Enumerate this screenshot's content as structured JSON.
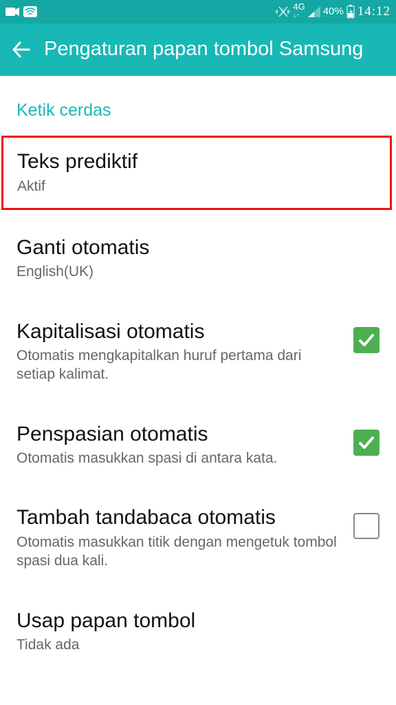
{
  "statusbar": {
    "network_label": "4G",
    "battery_pct": "40%",
    "time": "14:12"
  },
  "actionbar": {
    "title": "Pengaturan papan tombol Samsung"
  },
  "section": {
    "header": "Ketik cerdas"
  },
  "items": [
    {
      "title": "Teks prediktif",
      "sub": "Aktif"
    },
    {
      "title": "Ganti otomatis",
      "sub": "English(UK)"
    },
    {
      "title": "Kapitalisasi otomatis",
      "sub": "Otomatis mengkapitalkan huruf pertama dari setiap kalimat."
    },
    {
      "title": "Penspasian otomatis",
      "sub": "Otomatis masukkan spasi di antara kata."
    },
    {
      "title": "Tambah tandabaca otomatis",
      "sub": "Otomatis masukkan titik dengan mengetuk tombol spasi dua kali."
    },
    {
      "title": "Usap papan tombol",
      "sub": "Tidak ada"
    }
  ]
}
